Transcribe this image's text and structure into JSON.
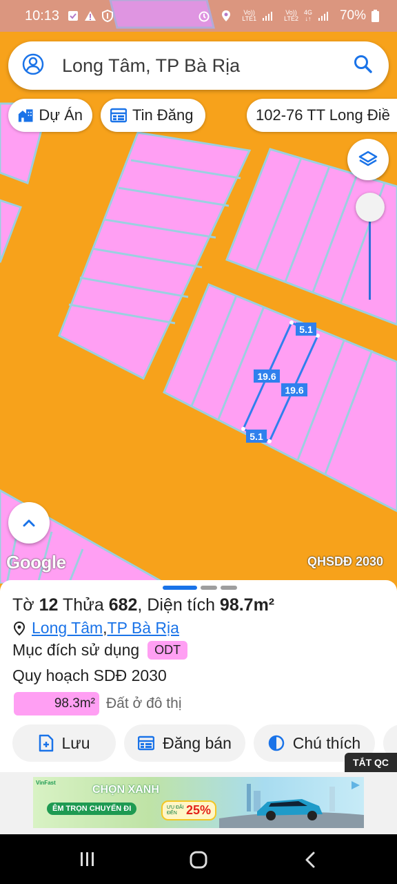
{
  "status_bar": {
    "time": "10:13",
    "net1_top": "Vo))",
    "net1_bottom": "LTE1",
    "net2_top": "Vo))",
    "net2_bottom": "LTE2",
    "data_type": "4G",
    "battery": "70%"
  },
  "search": {
    "text": "Long Tâm, TP Bà Rịa"
  },
  "chips": [
    {
      "label": "Dự Án",
      "icon": "building-icon"
    },
    {
      "label": "Tin Đăng",
      "icon": "listing-icon"
    },
    {
      "label": "102-76 TT Long Điề"
    }
  ],
  "map": {
    "dimensions": {
      "top": "5.1",
      "left": "19.6",
      "right": "19.6",
      "bottom": "5.1"
    },
    "google_logo": "Google",
    "layer_label": "QHSDĐ 2030",
    "colors": {
      "road": "#F7A21B",
      "land_residential": "#FF9FF3",
      "parcel_border": "#9BD0E0",
      "selection": "#2F80ED"
    }
  },
  "sheet": {
    "title_prefix": "Tờ ",
    "sheet_no": "12",
    "title_mid": " Thửa ",
    "parcel_no": "682",
    "title_area_label": ", Diện tích ",
    "area": "98.7m²",
    "location_ward": "Long Tâm",
    "location_sep": ", ",
    "location_city": "TP Bà Rịa",
    "usage_label": "Mục đích sử dụng",
    "usage_code": "ODT",
    "plan_label": "Quy hoạch SDĐ 2030",
    "plan_area": "98.3m²",
    "plan_desc": "Đất ở đô thị",
    "actions": {
      "save": "Lưu",
      "post_sale": "Đăng bán",
      "legend": "Chú thích"
    }
  },
  "ad": {
    "close_label": "TẮT QC",
    "brand": "VinFast",
    "headline": "CHỌN XANH",
    "sub": "ÊM TRỌN CHUYẾN ĐI",
    "promo_small": "ƯU ĐÃI ĐẾN",
    "promo_value": "25%"
  }
}
